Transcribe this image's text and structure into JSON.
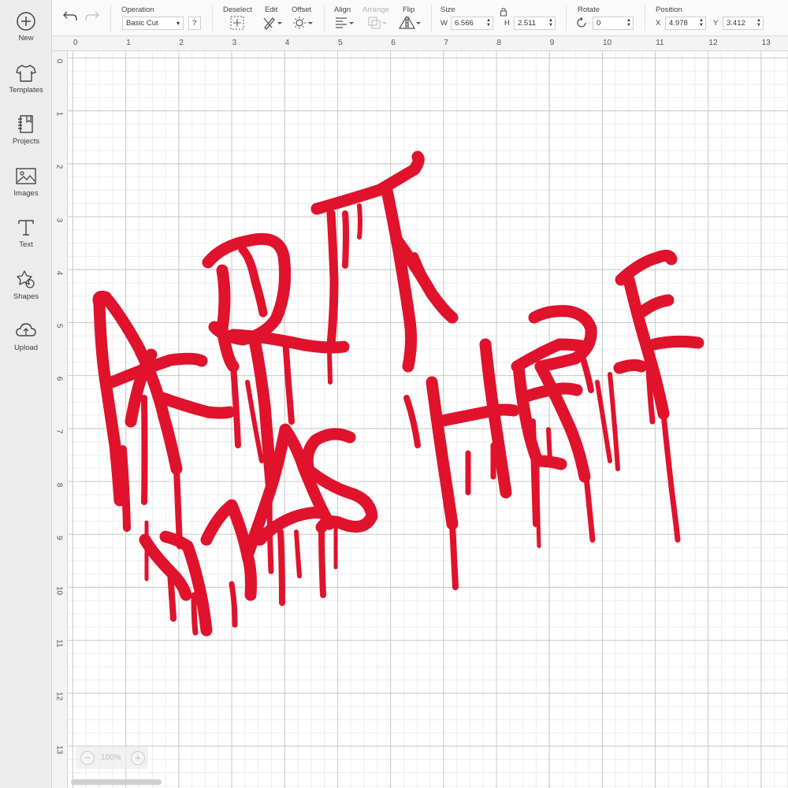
{
  "sidebar": {
    "items": [
      {
        "label": "New",
        "icon": "plus-circle-icon"
      },
      {
        "label": "Templates",
        "icon": "tshirt-icon"
      },
      {
        "label": "Projects",
        "icon": "notebook-icon"
      },
      {
        "label": "Images",
        "icon": "image-icon"
      },
      {
        "label": "Text",
        "icon": "text-icon"
      },
      {
        "label": "Shapes",
        "icon": "shapes-icon"
      },
      {
        "label": "Upload",
        "icon": "upload-cloud-icon"
      }
    ]
  },
  "toolbar": {
    "operation_label": "Operation",
    "operation_value": "Basic Cut",
    "help_label": "?",
    "deselect_label": "Deselect",
    "edit_label": "Edit",
    "offset_label": "Offset",
    "align_label": "Align",
    "arrange_label": "Arrange",
    "flip_label": "Flip",
    "size_label": "Size",
    "w_label": "W",
    "w_value": "6.566",
    "h_label": "H",
    "h_value": "2.511",
    "rotate_label": "Rotate",
    "rotate_value": "0",
    "position_label": "Position",
    "x_label": "X",
    "x_value": "4.978",
    "y_label": "Y",
    "y_value": "3.412"
  },
  "ruler": {
    "top": [
      "0",
      "1",
      "2",
      "3",
      "4",
      "5",
      "6",
      "7",
      "8",
      "9",
      "10",
      "11",
      "12",
      "13"
    ],
    "left": [
      "0",
      "1",
      "2",
      "3",
      "4",
      "5",
      "6",
      "7",
      "8",
      "9",
      "10",
      "11",
      "12",
      "13"
    ]
  },
  "zoom": {
    "minus": "−",
    "value": "100%",
    "plus": "+"
  },
  "colors": {
    "artwork": "#e0122c",
    "sidebar_bg": "#ececec",
    "toolbar_bg": "#fafafa"
  }
}
